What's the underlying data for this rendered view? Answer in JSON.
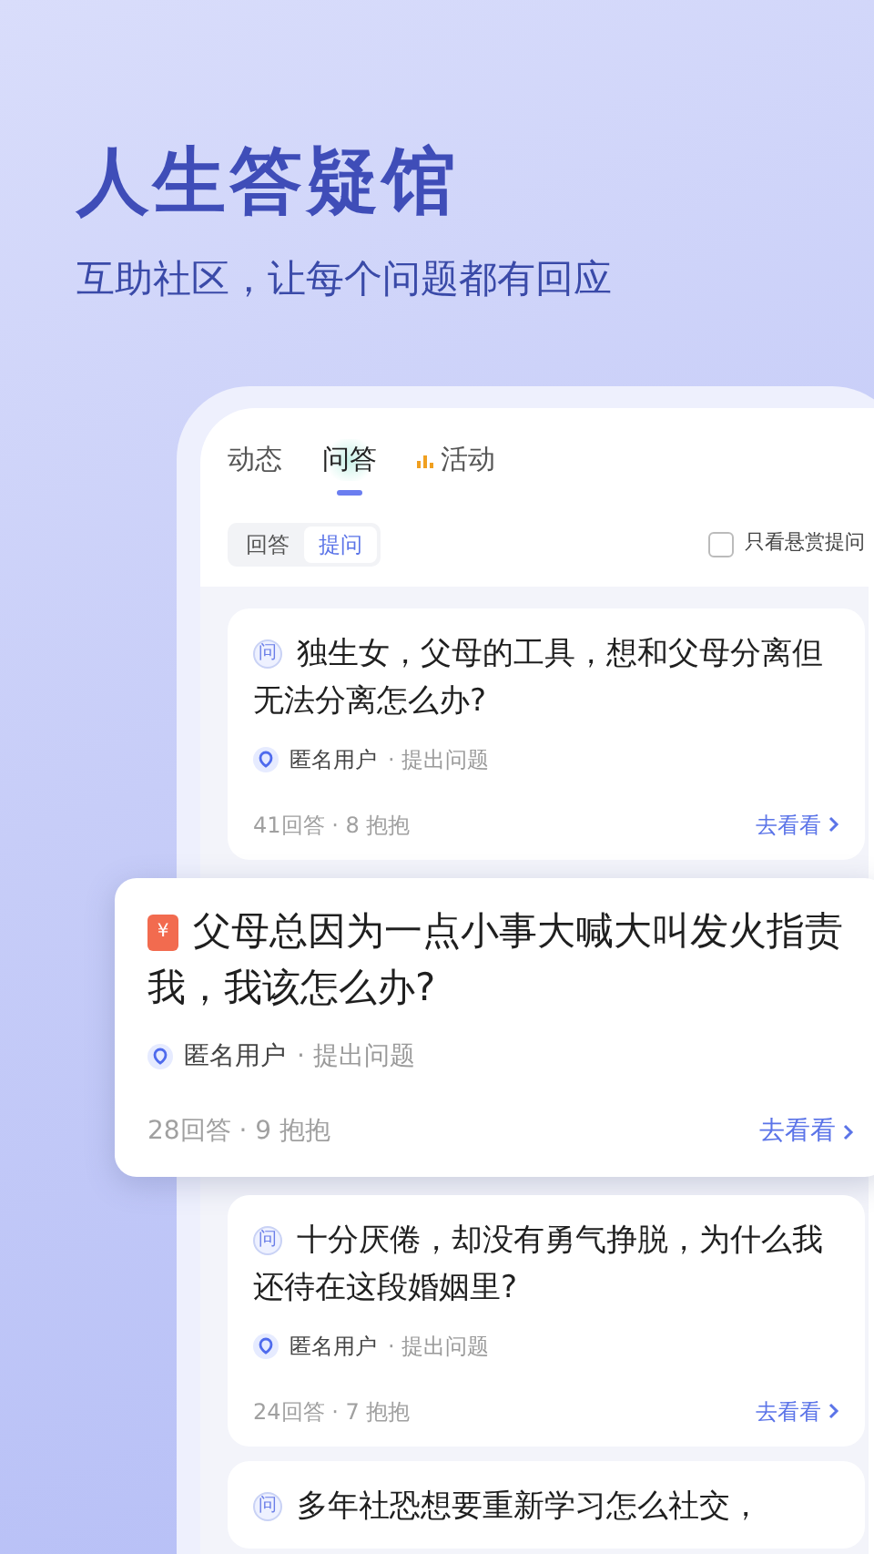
{
  "header": {
    "title": "人生答疑馆",
    "subtitle": "互助社区，让每个问题都有回应"
  },
  "tabs": [
    {
      "label": "动态",
      "selected": false,
      "icon": false
    },
    {
      "label": "问答",
      "selected": true,
      "icon": false
    },
    {
      "label": "活动",
      "selected": false,
      "icon": true
    }
  ],
  "segments": [
    {
      "label": "回答",
      "selected": false
    },
    {
      "label": "提问",
      "selected": true
    }
  ],
  "filter": {
    "label": "只看悬赏提问",
    "checked": false
  },
  "cards": [
    {
      "kind": "question",
      "badge": "问",
      "title": "独生女，父母的工具，想和父母分离但无法分离怎么办?",
      "user": "匿名用户",
      "action": "· 提出问题",
      "stats": "41回答 · 8 抱抱",
      "link": "去看看",
      "elevated": false
    },
    {
      "kind": "reward",
      "badge": "¥",
      "title": "父母总因为一点小事大喊大叫发火指责我，我该怎么办?",
      "user": "匿名用户",
      "action": "· 提出问题",
      "stats": "28回答 · 9 抱抱",
      "link": "去看看",
      "elevated": true
    },
    {
      "kind": "question",
      "badge": "问",
      "title": "十分厌倦，却没有勇气挣脱，为什么我还待在这段婚姻里?",
      "user": "匿名用户",
      "action": "· 提出问题",
      "stats": "24回答 · 7 抱抱",
      "link": "去看看",
      "elevated": false
    },
    {
      "kind": "question",
      "badge": "问",
      "title": "多年社恐想要重新学习怎么社交，",
      "elevated": false
    }
  ]
}
